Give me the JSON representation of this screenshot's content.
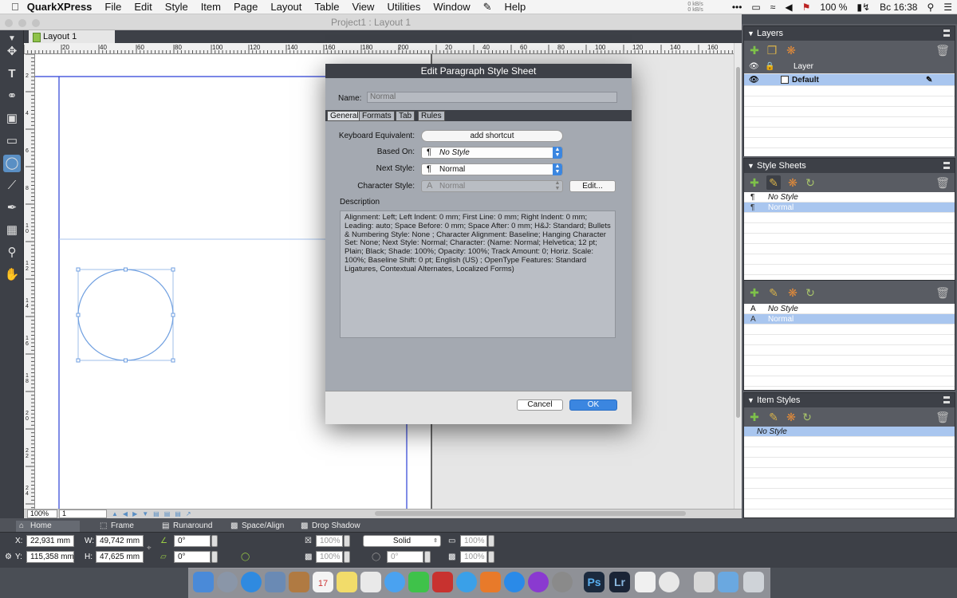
{
  "menubar": {
    "app": "QuarkXPress",
    "items": [
      "File",
      "Edit",
      "Style",
      "Item",
      "Page",
      "Layout",
      "Table",
      "View",
      "Utilities",
      "Window",
      "Help"
    ],
    "net_up": "0 kB/s",
    "net_down": "0 kB/s",
    "battery": "100 %",
    "clock": "Вс 16:38"
  },
  "window": {
    "title": "Project1 : Layout 1",
    "layout_tab": "Layout 1"
  },
  "ruler": {
    "h_labels": [
      "20",
      "40",
      "60",
      "80",
      "100",
      "120",
      "140",
      "160",
      "180",
      "200",
      "20",
      "40",
      "60",
      "80",
      "100",
      "120",
      "140",
      "160"
    ],
    "v_labels": [
      "2",
      "4",
      "6",
      "8",
      "10",
      "12",
      "14",
      "16",
      "18",
      "20",
      "22",
      "24"
    ]
  },
  "status": {
    "zoom": "100%",
    "page": "1"
  },
  "panels": {
    "layers": {
      "title": "Layers",
      "header": "Layer",
      "items": [
        {
          "name": "Default"
        }
      ]
    },
    "style_sheets": {
      "title": "Style Sheets",
      "paragraph_items": [
        "No Style",
        "Normal"
      ],
      "character_items": [
        "No Style",
        "Normal"
      ]
    },
    "item_styles": {
      "title": "Item Styles",
      "items": [
        "No Style"
      ]
    }
  },
  "measurements": {
    "tabs": [
      "Home",
      "Frame",
      "Runaround",
      "Space/Align",
      "Drop Shadow"
    ],
    "x_label": "X:",
    "x": "22,931 mm",
    "y_label": "Y:",
    "y": "115,358 mm",
    "w_label": "W:",
    "w": "49,742 mm",
    "h_label": "H:",
    "h": "47,625 mm",
    "angle1": "0°",
    "angle2": "0°",
    "line_style": "Solid",
    "pct1": "100%",
    "pct2": "100%",
    "pct3": "100%",
    "pct4": "100%",
    "angle3": "0°"
  },
  "dialog": {
    "title": "Edit Paragraph Style Sheet",
    "name_label": "Name:",
    "name_value": "Normal",
    "tabs": [
      "General",
      "Formats",
      "Tab",
      "Rules"
    ],
    "keyboard_label": "Keyboard Equivalent:",
    "keyboard_button": "add shortcut",
    "based_on_label": "Based On:",
    "based_on_value": "No Style",
    "next_style_label": "Next Style:",
    "next_style_value": "Normal",
    "char_style_label": "Character Style:",
    "char_style_value": "Normal",
    "edit_button": "Edit...",
    "description_label": "Description",
    "description": "Alignment: Left;   Left Indent: 0 mm;   First Line: 0 mm;   Right Indent: 0 mm;   Leading: auto;   Space Before: 0 mm;   Space After: 0 mm;   H&J: Standard;   Bullets & Numbering Style: None ;   Character Alignment: Baseline;   Hanging Character Set: None;   Next Style: Normal;   Character: (Name: Normal;   Helvetica;   12 pt;   Plain;   Black;   Shade: 100%;   Opacity: 100%;   Track Amount: 0;   Horiz. Scale: 100%;   Baseline Shift: 0 pt;   English (US) ;   OpenType Features: Standard Ligatures, Contextual Alternates, Localized Forms)",
    "cancel": "Cancel",
    "ok": "OK"
  },
  "colors": {
    "accent": "#3b86e0",
    "selection": "#a9c6ef",
    "guide": "#2b3fd6",
    "frame": "#6f9fe0"
  }
}
